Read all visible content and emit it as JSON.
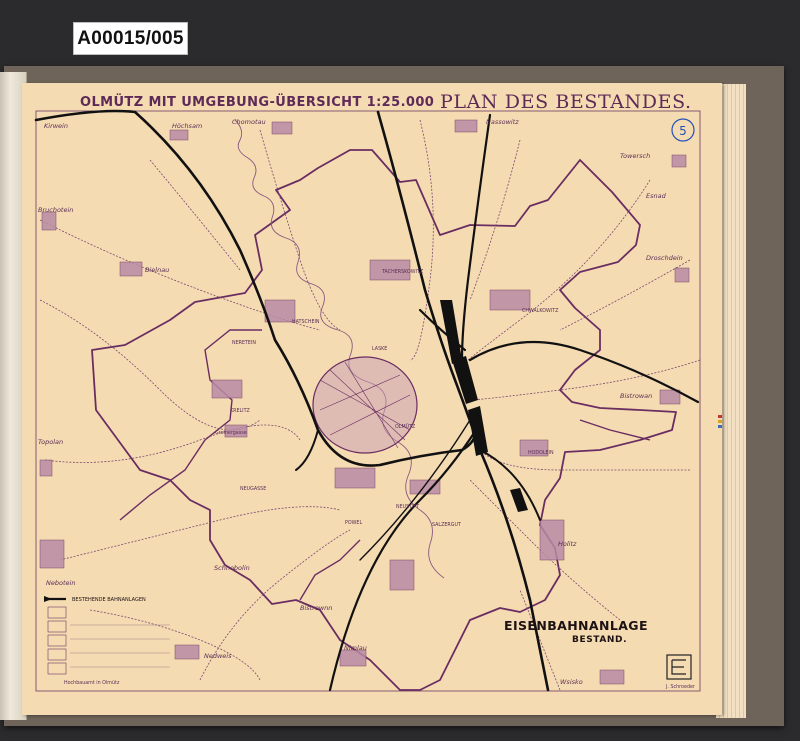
{
  "archive_label": "A00015/005",
  "map": {
    "title_left": "OLMÜTZ MIT UMGEBUNG-ÜBERSICHT 1:25.000",
    "title_right": "PLAN DES BESTANDES.",
    "sheet_number": "5",
    "railway_title": "EISENBAHNANLAGE",
    "railway_subtitle": "BESTAND.",
    "legend_first_entry": "BESTEHENDE BAHNANLAGEN",
    "bottom_left_note": "Hochbauamt in Olmütz",
    "signature": "J. Schroeder",
    "colors": {
      "paper": "#f5dbb2",
      "ink": "#5e2a57",
      "rail": "#111111",
      "sheet_number": "#2450b8"
    },
    "places": {
      "kirwein": "Kirwein",
      "hoechsam": "Höchsam",
      "chomotau": "Chomotau",
      "nassowitz": "Nassowitz",
      "towersch": "Towersch",
      "esnad": "Esnad",
      "bruchotein": "Bruchotein",
      "bielnau": "Bielnau",
      "droschdein": "Droschdein",
      "tacherskowitz": "TACHERSKOWITZ",
      "chwalkowitz": "CHWALKOWITZ",
      "laske": "LASKE",
      "hatschein": "HATSCHEIN",
      "neugasse": "NEUGASSE",
      "olmuetz": "OLMÜTZ",
      "bistrowan": "Bistrowan",
      "topolan": "Topolan",
      "krelitz": "KRELITZ",
      "povel": "POWEL",
      "salzergut": "SALZERGUT",
      "hodolein": "HODOLEIN",
      "neustift": "NEUSTIFT",
      "holitz": "Holitz",
      "nebotein": "Nebotein",
      "schnobolin": "Schnobolin",
      "grosswisternitz": "Bistrownn",
      "nedweis": "Nedweis",
      "nimlau": "Nimlau",
      "wsisko": "Wsisko",
      "neretein": "NERETEIN",
      "greinergasse": "Greinergasse"
    }
  }
}
